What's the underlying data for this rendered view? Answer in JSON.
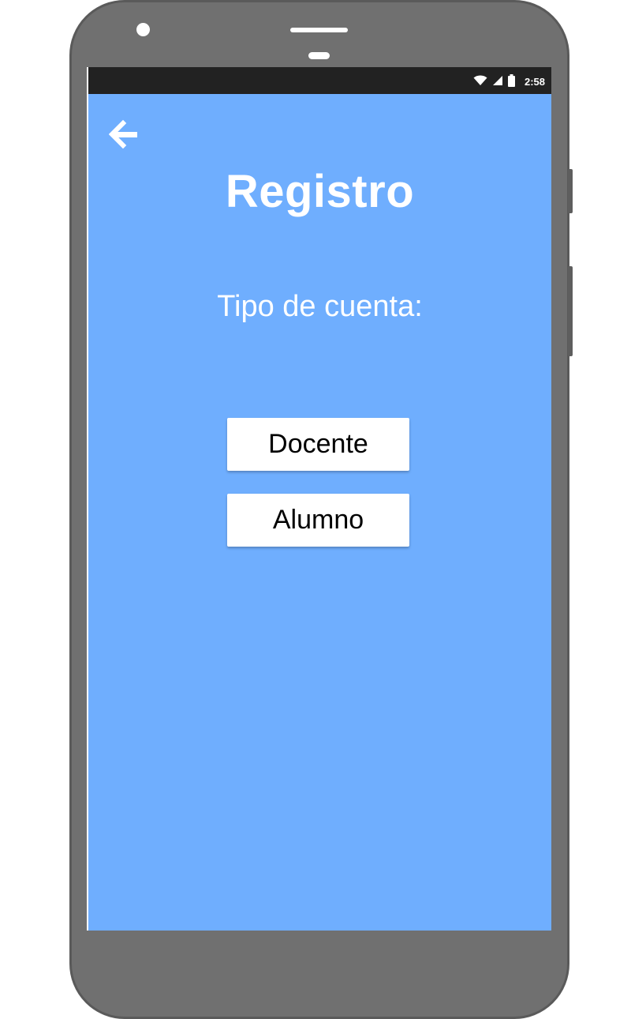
{
  "status_bar": {
    "time": "2:58",
    "icons": [
      "wifi-icon",
      "signal-icon",
      "battery-icon"
    ]
  },
  "header": {
    "back_icon": "arrow-left-icon",
    "title": "Registro"
  },
  "main": {
    "prompt": "Tipo de cuenta:",
    "options": [
      {
        "label": "Docente"
      },
      {
        "label": "Alumno"
      }
    ]
  },
  "colors": {
    "background": "#6faefe",
    "status_bar": "#222222",
    "button_bg": "#ffffff",
    "text_light": "#ffffff",
    "device_frame": "#707070"
  }
}
